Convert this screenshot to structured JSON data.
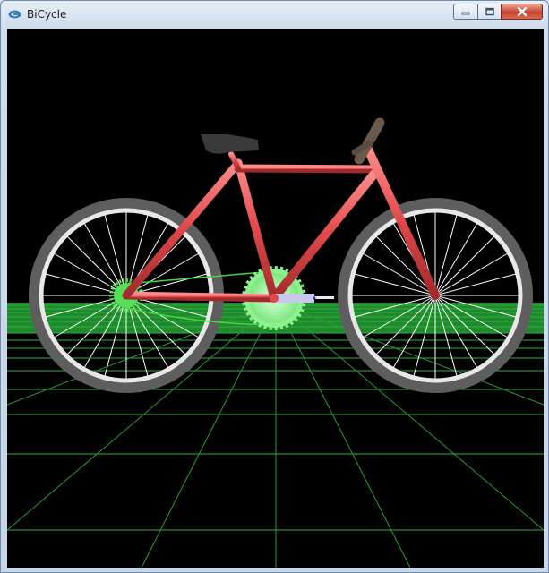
{
  "window": {
    "title": "BiCycle",
    "app_icon": "opengl-app-icon",
    "controls": {
      "minimize_icon": "minimize-icon",
      "maximize_icon": "maximize-icon",
      "close_icon": "close-icon"
    }
  },
  "scene": {
    "background_color": "#000000",
    "grid_color": "#2fae45",
    "ground_color": "#1f8a2c",
    "frame_color": "#e0474a",
    "tire_color": "#5e5e5e",
    "rim_color": "#e8e8e8",
    "spoke_color": "#ffffff",
    "gear_color": "#8ff08f",
    "seat_color": "#3a3a3a",
    "pedal_color": "#c9c9ee",
    "chain_color": "#3fd83f"
  }
}
